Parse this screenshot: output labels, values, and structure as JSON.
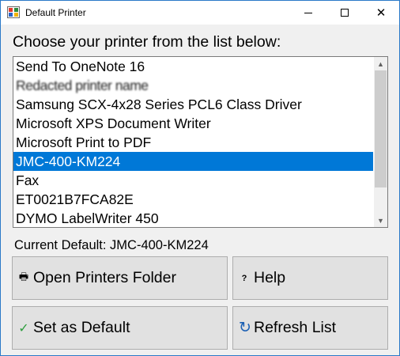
{
  "window": {
    "title": "Default Printer",
    "app_icon": "printer-app-icon",
    "caption_icons": {
      "minimize": "minimize-icon",
      "maximize": "maximize-icon",
      "close": "close-icon"
    },
    "close_glyph": "✕"
  },
  "prompt": "Choose your printer from the list below:",
  "printers": [
    {
      "label": "Send To OneNote 16",
      "selected": false
    },
    {
      "label": "Redacted printer name",
      "selected": false,
      "scribbled": true
    },
    {
      "label": "Samsung SCX-4x28 Series PCL6 Class Driver",
      "selected": false
    },
    {
      "label": "Microsoft XPS Document Writer",
      "selected": false
    },
    {
      "label": "Microsoft Print to PDF",
      "selected": false
    },
    {
      "label": "JMC-400-KM224",
      "selected": true
    },
    {
      "label": "Fax",
      "selected": false
    },
    {
      "label": "ET0021B7FCA82E",
      "selected": false
    },
    {
      "label": "DYMO LabelWriter 450",
      "selected": false
    }
  ],
  "scrollbar": {
    "up_glyph": "▲",
    "down_glyph": "▼"
  },
  "current_default": "Current Default: JMC-400-KM224",
  "buttons": {
    "open_folder": {
      "label": "Open Printers Folder",
      "glyph": "🖶",
      "icon": "printer-icon"
    },
    "help": {
      "label": "Help",
      "glyph": "?",
      "icon": "help-icon"
    },
    "set_default": {
      "label": "Set as Default",
      "glyph": "✓",
      "icon": "checkmark-icon"
    },
    "refresh": {
      "label": "Refresh List",
      "glyph": "↻",
      "icon": "refresh-icon"
    }
  },
  "colors": {
    "selection": "#0078d7",
    "window_border": "#2b79c8",
    "button_face": "#e1e1e1"
  }
}
